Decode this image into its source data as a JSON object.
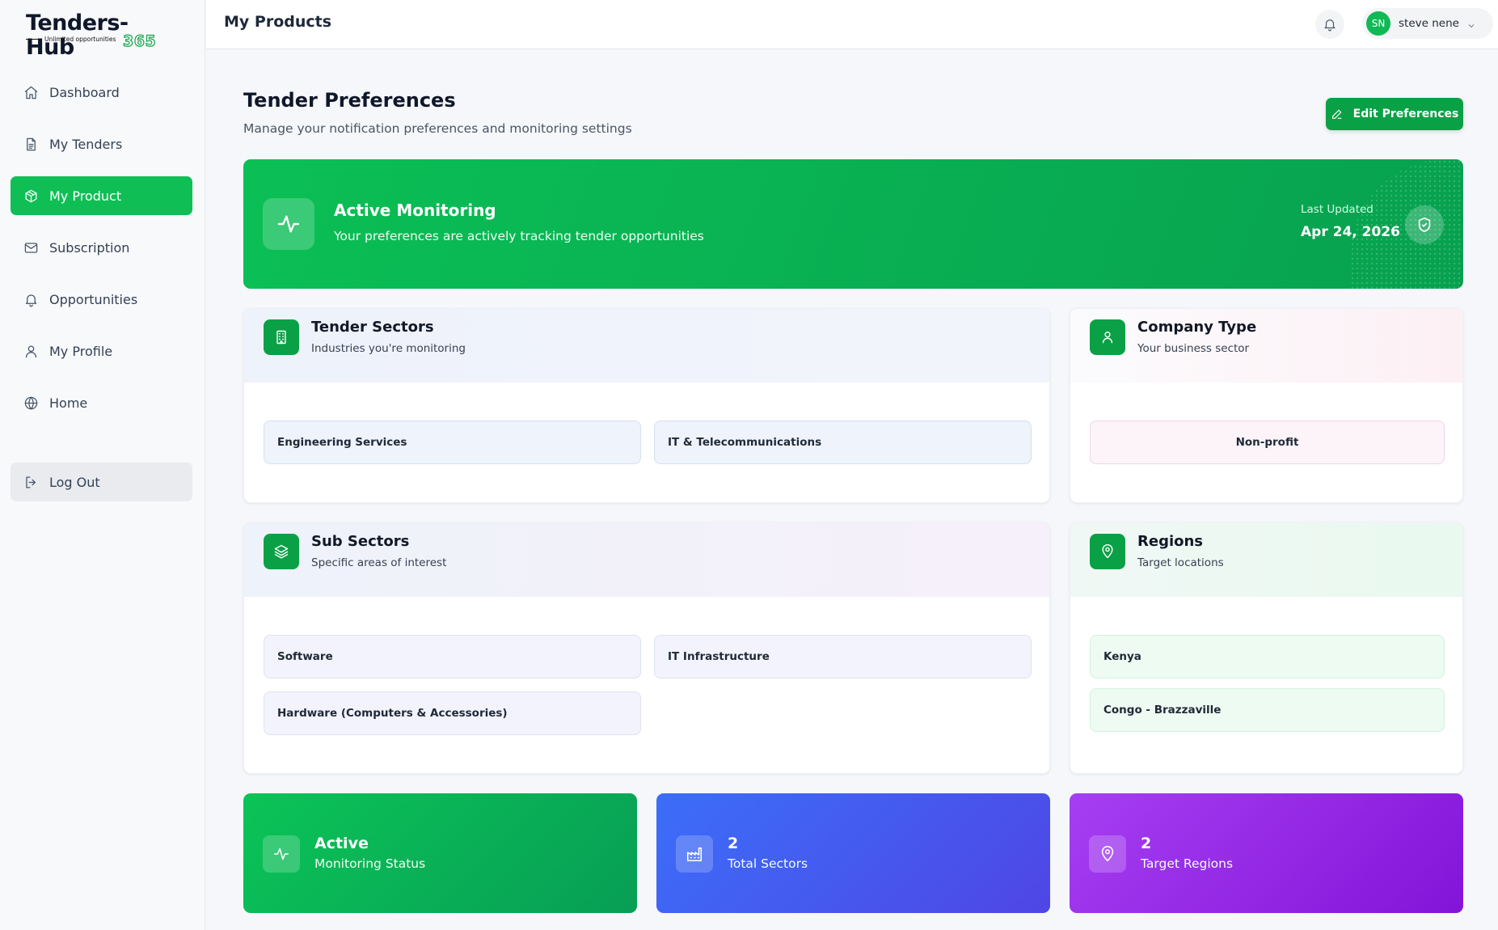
{
  "brand": {
    "logo_main": "Tenders-Hub",
    "logo_tagline": "Unlimited opportunities",
    "logo_suffix": "365",
    "accent": "#0fbf55"
  },
  "sidebar": {
    "items": [
      {
        "label": "Dashboard",
        "icon": "home-icon"
      },
      {
        "label": "My Tenders",
        "icon": "document-icon"
      },
      {
        "label": "My Product",
        "icon": "package-icon",
        "active": true
      },
      {
        "label": "Subscription",
        "icon": "mail-icon"
      },
      {
        "label": "Opportunities",
        "icon": "bell-icon"
      },
      {
        "label": "My Profile",
        "icon": "user-icon"
      },
      {
        "label": "Home",
        "icon": "globe-icon"
      }
    ],
    "logout_label": "Log Out"
  },
  "header": {
    "title": "My Products",
    "user_initials": "SN",
    "user_name": "steve nene"
  },
  "preferences": {
    "title": "Tender Preferences",
    "subtitle": "Manage your notification preferences and monitoring settings",
    "edit_label": "Edit Preferences"
  },
  "monitoring": {
    "title": "Active Monitoring",
    "subtitle": "Your preferences are actively tracking tender opportunities",
    "last_updated_label": "Last Updated",
    "last_updated_value": "Apr 24, 2026"
  },
  "cards": {
    "tender_sectors": {
      "title": "Tender Sectors",
      "subtitle": "Industries you're monitoring",
      "items": [
        "Engineering Services",
        "IT & Telecommunications"
      ]
    },
    "company_type": {
      "title": "Company Type",
      "subtitle": "Your business sector",
      "value": "Non-profit"
    },
    "sub_sectors": {
      "title": "Sub Sectors",
      "subtitle": "Specific areas of interest",
      "items": [
        "Software",
        "IT Infrastructure",
        "Hardware (Computers & Accessories)"
      ]
    },
    "regions": {
      "title": "Regions",
      "subtitle": "Target locations",
      "items": [
        "Kenya",
        "Congo - Brazzaville"
      ]
    }
  },
  "stats": [
    {
      "value": "Active",
      "label": "Monitoring Status",
      "color": "#0bc457"
    },
    {
      "value": "2",
      "label": "Total Sectors",
      "color": "#3b6ef8"
    },
    {
      "value": "2",
      "label": "Target Regions",
      "color": "#a63ff3"
    }
  ]
}
